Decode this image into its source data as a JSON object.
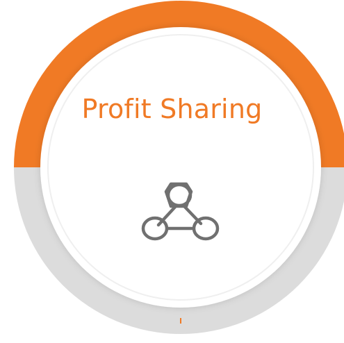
{
  "badge": {
    "title": "Profit Sharing",
    "icon": "network-nodes-icon",
    "colors": {
      "accent": "#F07A25",
      "ring_track": "#DCDCDC",
      "inner_fill": "#FFFFFF",
      "inner_border": "#EFEFEF",
      "icon": "#707070"
    }
  }
}
